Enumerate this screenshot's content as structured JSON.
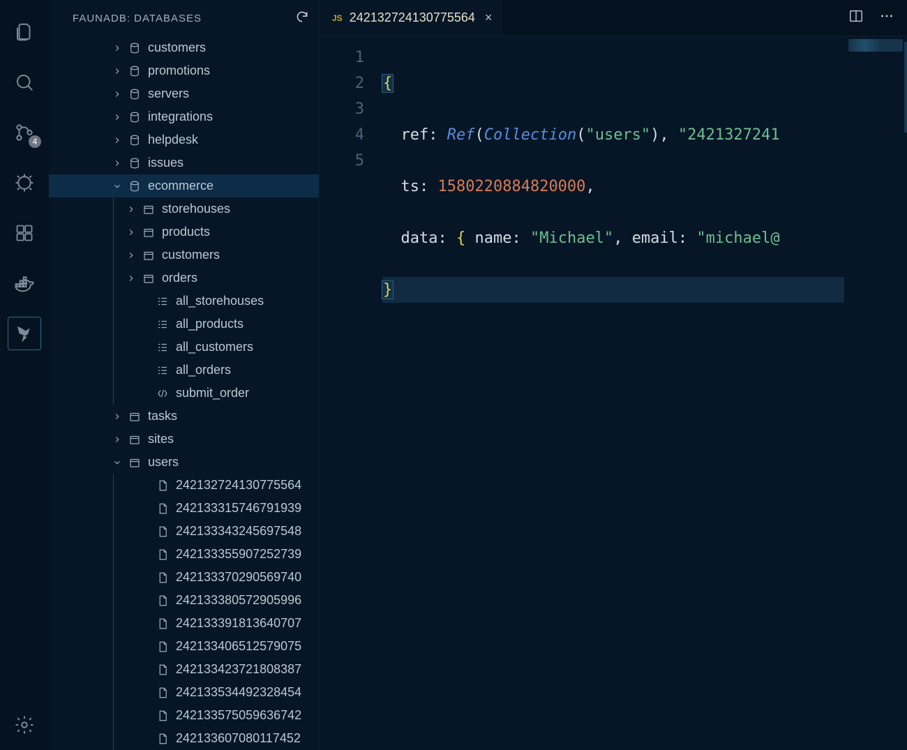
{
  "sidebar": {
    "title": "FAUNADB: DATABASES",
    "scm_badge": "4"
  },
  "tree": {
    "databases": [
      {
        "name": "customers"
      },
      {
        "name": "promotions"
      },
      {
        "name": "servers"
      },
      {
        "name": "integrations"
      },
      {
        "name": "helpdesk"
      },
      {
        "name": "issues"
      }
    ],
    "ecommerce": {
      "name": "ecommerce",
      "collections": [
        {
          "name": "storehouses"
        },
        {
          "name": "products"
        },
        {
          "name": "customers"
        },
        {
          "name": "orders"
        }
      ],
      "indexes": [
        {
          "name": "all_storehouses"
        },
        {
          "name": "all_products"
        },
        {
          "name": "all_customers"
        },
        {
          "name": "all_orders"
        }
      ],
      "functions": [
        {
          "name": "submit_order"
        }
      ]
    },
    "tasks": {
      "name": "tasks"
    },
    "sites": {
      "name": "sites"
    },
    "users": {
      "name": "users",
      "docs": [
        "242132724130775564",
        "242133315746791939",
        "242133343245697548",
        "242133355907252739",
        "242133370290569740",
        "242133380572905996",
        "242133391813640707",
        "242133406512579075",
        "242133423721808387",
        "242133534492328454",
        "242133575059636742",
        "242133607080117452"
      ]
    }
  },
  "tab": {
    "lang": "JS",
    "title": "242132724130775564",
    "close": "×"
  },
  "code": {
    "lines": [
      "1",
      "2",
      "3",
      "4",
      "5"
    ],
    "ref_key": "ref",
    "ref_func": "Ref",
    "coll_func": "Collection",
    "coll_arg": "\"users\"",
    "ref_id_partial": "\"2421327241",
    "ts_key": "ts",
    "ts_value": "1580220884820000",
    "data_key": "data",
    "name_key": "name",
    "name_value": "\"Michael\"",
    "email_key": "email",
    "email_value_partial": "\"michael@"
  }
}
